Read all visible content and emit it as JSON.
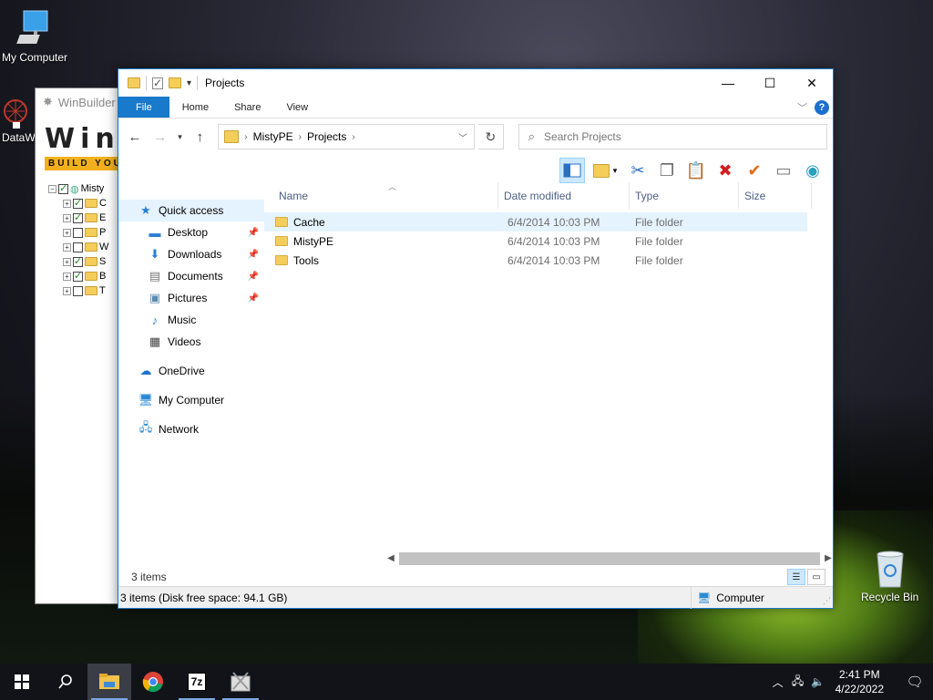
{
  "desktop": {
    "my_computer": "My Computer",
    "datawall": "DataW",
    "recycle_bin": "Recycle Bin"
  },
  "winbuilder": {
    "title": "WinBuilder",
    "logo_big": "Win",
    "logo_strip": "BUILD YOU",
    "root": "Misty",
    "rows": [
      {
        "label": "C",
        "checked": true
      },
      {
        "label": "E",
        "checked": true
      },
      {
        "label": "P",
        "checked": false
      },
      {
        "label": "W",
        "checked": false
      },
      {
        "label": "S",
        "checked": true
      },
      {
        "label": "B",
        "checked": true
      },
      {
        "label": "T",
        "checked": false
      }
    ]
  },
  "explorer": {
    "title": "Projects",
    "tabs": {
      "file": "File",
      "home": "Home",
      "share": "Share",
      "view": "View"
    },
    "help": "?",
    "address": {
      "crumbs": [
        "MistyPE",
        "Projects"
      ]
    },
    "search": {
      "placeholder": "Search Projects"
    },
    "nav": {
      "quick_access": "Quick access",
      "desktop": "Desktop",
      "downloads": "Downloads",
      "documents": "Documents",
      "pictures": "Pictures",
      "music": "Music",
      "videos": "Videos",
      "onedrive": "OneDrive",
      "my_computer": "My Computer",
      "network": "Network"
    },
    "columns": {
      "name": "Name",
      "date": "Date modified",
      "type": "Type",
      "size": "Size"
    },
    "files": [
      {
        "name": "Cache",
        "date": "6/4/2014 10:03 PM",
        "type": "File folder"
      },
      {
        "name": "MistyPE",
        "date": "6/4/2014 10:03 PM",
        "type": "File folder"
      },
      {
        "name": "Tools",
        "date": "6/4/2014 10:03 PM",
        "type": "File folder"
      }
    ],
    "item_count": "3 items",
    "status": "3 items (Disk free space: 94.1 GB)",
    "status_zone": "Computer"
  },
  "taskbar": {
    "time": "2:41 PM",
    "date": "4/22/2022",
    "apps": [
      "start-icon",
      "search-icon",
      "file-explorer-icon",
      "chrome-icon",
      "7zip-icon",
      "winbuilder-icon"
    ]
  },
  "colors": {
    "accent": "#1979ca",
    "selection": "#e5f3ff",
    "folder": "#f5cd5a"
  }
}
